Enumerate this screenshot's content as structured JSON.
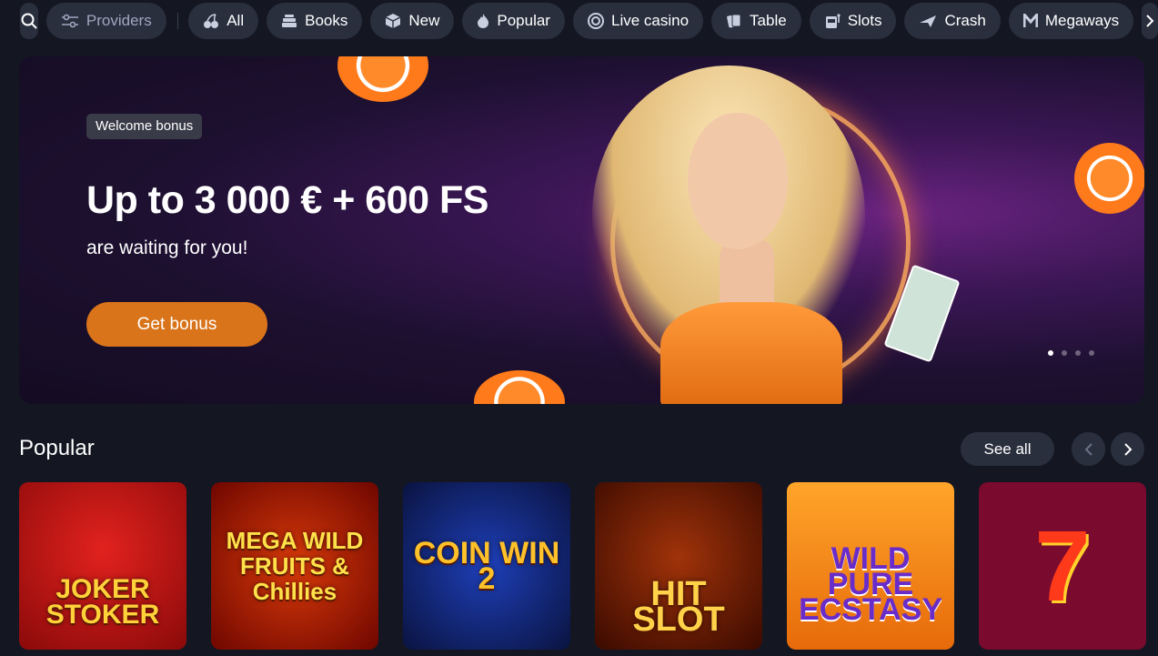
{
  "nav": {
    "providers": "Providers",
    "categories": [
      {
        "label": "All",
        "icon": "cherries-icon"
      },
      {
        "label": "Books",
        "icon": "books-icon"
      },
      {
        "label": "New",
        "icon": "cube-icon"
      },
      {
        "label": "Popular",
        "icon": "flame-icon"
      },
      {
        "label": "Live casino",
        "icon": "chip-icon"
      },
      {
        "label": "Table",
        "icon": "cards-icon"
      },
      {
        "label": "Slots",
        "icon": "slot-machine-icon"
      },
      {
        "label": "Crash",
        "icon": "plane-icon"
      },
      {
        "label": "Megaways",
        "icon": "megaways-icon"
      }
    ]
  },
  "banner": {
    "badge": "Welcome bonus",
    "title": "Up to 3 000 € + 600 FS",
    "subtitle": "are waiting for you!",
    "button": "Get bonus",
    "slides": 4,
    "active_slide": 1
  },
  "popular": {
    "title": "Popular",
    "see_all": "See all",
    "games": [
      {
        "title": "JOKER STOKER"
      },
      {
        "title": "MEGA WILD FRUITS & Chillies"
      },
      {
        "title": "COIN WIN 2"
      },
      {
        "title": "HIT SLOT"
      },
      {
        "title": "WILD PURE ECSTASY"
      },
      {
        "title": ""
      }
    ]
  },
  "colors": {
    "background": "#141722",
    "pill": "#2a2f3e",
    "accent": "#d9741a"
  }
}
